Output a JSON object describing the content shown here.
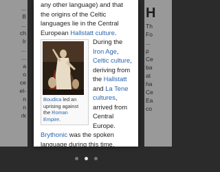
{
  "left_peek": {
    "lines": [
      "...",
      "B",
      "...",
      "ch",
      "Ir",
      "...",
      "...",
      "a",
      "o",
      "ce",
      "el-",
      "n",
      "n",
      "rk"
    ]
  },
  "right_peek": {
    "big_letter": "H",
    "lines": [
      "Th",
      "Fo",
      "...",
      "p",
      "Ce",
      "ba",
      "at",
      "ha",
      "Ce",
      "Ea",
      "co"
    ]
  },
  "article": {
    "para1_a": "any other language) and that the origins of the Celtic languages lie in the Central European ",
    "para1_link": "Hallstatt culture",
    "para1_b": ".",
    "figure_caption_link1": "Boudica",
    "figure_caption_mid": " led an uprising against the ",
    "figure_caption_link2": "Roman Empire",
    "figure_caption_end": ".",
    "figure_image_alt": "Boudica statue",
    "para2_a": "During the ",
    "para2_link1": "Iron Age",
    "para2_b": ", ",
    "para2_link2": "Celtic culture",
    "para2_c": ", deriving from the ",
    "para2_link3": "Hallstatt",
    "para2_d": " and ",
    "para2_link4": "La Tene cultures",
    "para2_e": ", arrived from Central Europe. ",
    "para2_link5": "Brythonic",
    "para2_f": " was the spoken language during this time. Society was tribal; accord-"
  },
  "pager": {
    "count": 3,
    "active": 1
  },
  "colors": {
    "link": "#2a64b0",
    "background": "#2b2b2b"
  }
}
